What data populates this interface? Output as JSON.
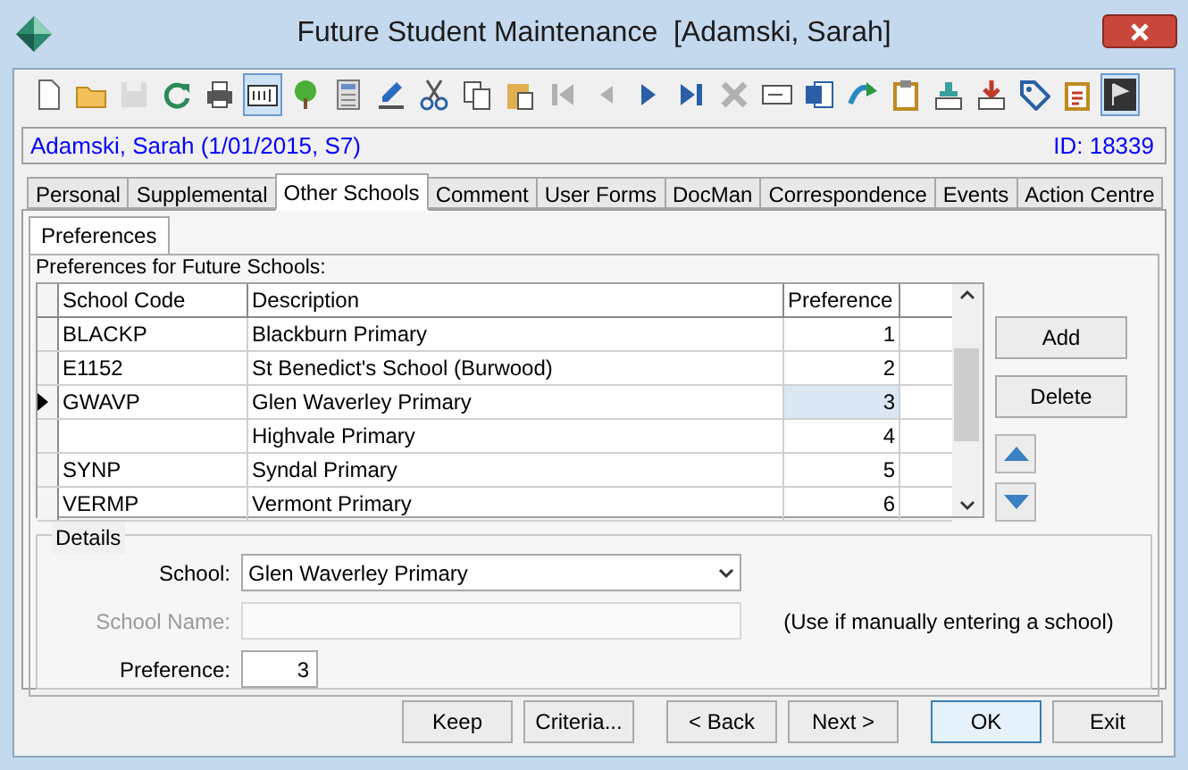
{
  "window": {
    "title": "Future Student Maintenance  [Adamski, Sarah]"
  },
  "toolbar": [
    {
      "kind": "new",
      "disabled": false,
      "selected": false
    },
    {
      "kind": "folder",
      "disabled": false,
      "selected": false
    },
    {
      "kind": "save",
      "disabled": true,
      "selected": false
    },
    {
      "kind": "refresh",
      "disabled": false,
      "selected": false
    },
    {
      "kind": "print",
      "disabled": false,
      "selected": false
    },
    {
      "kind": "textfield",
      "disabled": false,
      "selected": true
    },
    {
      "kind": "tree",
      "disabled": false,
      "selected": false
    },
    {
      "kind": "calculator",
      "disabled": false,
      "selected": false
    },
    {
      "kind": "spell",
      "disabled": false,
      "selected": false
    },
    {
      "kind": "cut",
      "disabled": false,
      "selected": false
    },
    {
      "kind": "copy",
      "disabled": false,
      "selected": false
    },
    {
      "kind": "paste",
      "disabled": false,
      "selected": false
    },
    {
      "kind": "first",
      "disabled": true,
      "selected": false
    },
    {
      "kind": "prev",
      "disabled": true,
      "selected": false
    },
    {
      "kind": "next",
      "disabled": false,
      "selected": false
    },
    {
      "kind": "last",
      "disabled": false,
      "selected": false
    },
    {
      "kind": "delete",
      "disabled": true,
      "selected": false
    },
    {
      "kind": "card",
      "disabled": false,
      "selected": false
    },
    {
      "kind": "word",
      "disabled": false,
      "selected": false
    },
    {
      "kind": "send",
      "disabled": false,
      "selected": false
    },
    {
      "kind": "clipboard",
      "disabled": false,
      "selected": false
    },
    {
      "kind": "tray-check",
      "disabled": false,
      "selected": false
    },
    {
      "kind": "tray-down",
      "disabled": false,
      "selected": false
    },
    {
      "kind": "tag",
      "disabled": false,
      "selected": false
    },
    {
      "kind": "clipboard-check",
      "disabled": false,
      "selected": false
    },
    {
      "kind": "flag",
      "disabled": false,
      "selected": true
    }
  ],
  "student_bar": {
    "name": "Adamski, Sarah (1/01/2015, S7)",
    "id": "ID: 18339"
  },
  "tabs": [
    {
      "label": "Personal",
      "selected": false
    },
    {
      "label": "Supplemental",
      "selected": false
    },
    {
      "label": "Other Schools",
      "selected": true
    },
    {
      "label": "Comment",
      "selected": false
    },
    {
      "label": "User Forms",
      "selected": false
    },
    {
      "label": "DocMan",
      "selected": false
    },
    {
      "label": "Correspondence",
      "selected": false
    },
    {
      "label": "Events",
      "selected": false
    },
    {
      "label": "Action Centre",
      "selected": false
    }
  ],
  "subtabs": [
    {
      "label": "Preferences",
      "selected": true
    }
  ],
  "preferences": {
    "label": "Preferences for Future Schools:",
    "columns": [
      "School Code",
      "Description",
      "Preference"
    ],
    "rows": [
      {
        "code": "BLACKP",
        "description": "Blackburn Primary",
        "preference": "1",
        "selected": false
      },
      {
        "code": "E1152",
        "description": "St Benedict's School (Burwood)",
        "preference": "2",
        "selected": false
      },
      {
        "code": "GWAVP",
        "description": "Glen Waverley Primary",
        "preference": "3",
        "selected": true
      },
      {
        "code": "",
        "description": "Highvale Primary",
        "preference": "4",
        "selected": false
      },
      {
        "code": "SYNP",
        "description": "Syndal Primary",
        "preference": "5",
        "selected": false
      },
      {
        "code": "VERMP",
        "description": "Vermont Primary",
        "preference": "6",
        "selected": false
      }
    ],
    "buttons": [
      "Add",
      "Delete"
    ]
  },
  "details": {
    "title": "Details",
    "school": {
      "label": "School:",
      "value": "Glen Waverley Primary"
    },
    "school_name": {
      "label": "School Name:",
      "disabled": true,
      "hint": "(Use if manually entering a school)"
    },
    "preference": {
      "label": "Preference:",
      "value": "3"
    }
  },
  "buttons": [
    {
      "label": "Keep",
      "default": false
    },
    {
      "label": "Criteria...",
      "default": false
    },
    {
      "label": "< Back",
      "default": false
    },
    {
      "label": "Next >",
      "default": false
    },
    {
      "label": "OK",
      "default": true
    },
    {
      "label": "Exit",
      "default": false
    }
  ]
}
